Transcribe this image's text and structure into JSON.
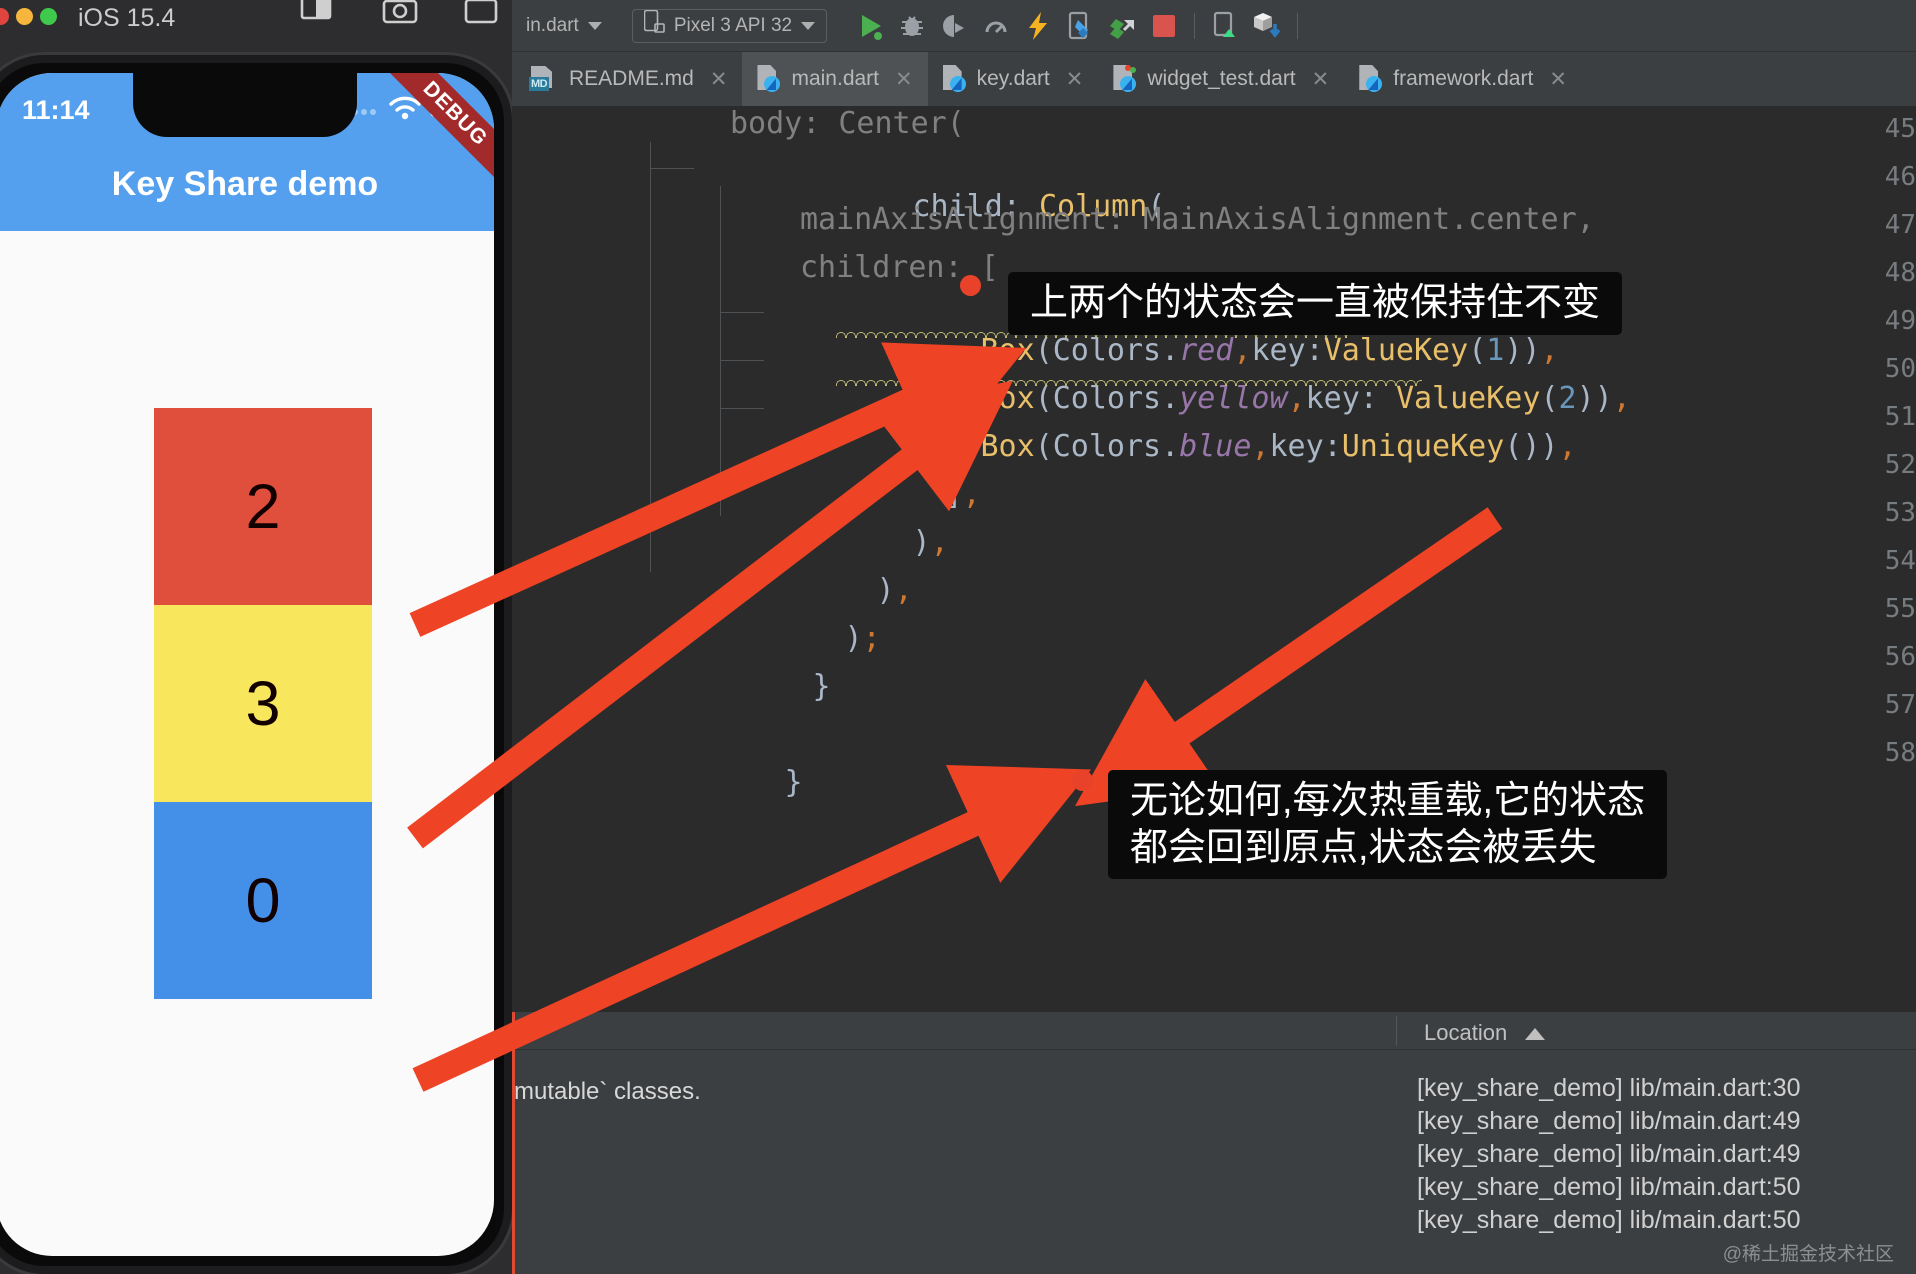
{
  "ide": {
    "toolbar": {
      "run_config": "in.dart",
      "device": "Pixel 3 API 32",
      "icons": [
        "run-icon",
        "debug-icon",
        "profile-icon",
        "coverage-icon",
        "hot-reload-icon",
        "flutter-inspector-icon",
        "flutter-outline-icon",
        "stop-icon",
        "device-manager-icon",
        "sdk-manager-icon"
      ]
    },
    "tabs": [
      {
        "label": "README.md",
        "icon": "markdown-file-icon",
        "active": false
      },
      {
        "label": "main.dart",
        "icon": "dart-file-icon",
        "active": true
      },
      {
        "label": "key.dart",
        "icon": "dart-file-icon",
        "active": false
      },
      {
        "label": "widget_test.dart",
        "icon": "flutter-test-file-icon",
        "active": false
      },
      {
        "label": "framework.dart",
        "icon": "dart-file-icon",
        "active": false
      }
    ],
    "editor": {
      "lines": [
        {
          "num": "45",
          "text": "body: Center("
        },
        {
          "num": "46",
          "text": "child: Column("
        },
        {
          "num": "47",
          "text": "mainAxisAlignment: MainAxisAlignment.center,"
        },
        {
          "num": "48",
          "text": "children: ["
        },
        {
          "num": "49",
          "text": "Box(Colors.red,key:ValueKey(1)),"
        },
        {
          "num": "50",
          "text": "Box(Colors.yellow,key: ValueKey(2)),"
        },
        {
          "num": "51",
          "text": "Box(Colors.blue,key:UniqueKey()),"
        },
        {
          "num": "52",
          "text": "],"
        },
        {
          "num": "53",
          "text": "),"
        },
        {
          "num": "54",
          "text": "),"
        },
        {
          "num": "55",
          "text": ");"
        },
        {
          "num": "56",
          "text": "}"
        },
        {
          "num": "57",
          "text": ""
        },
        {
          "num": "58",
          "text": "}"
        }
      ],
      "gutter_swatches": [
        "#e8432a",
        "#f6e23c",
        "#3f8fe8"
      ]
    },
    "bottom_panel": {
      "left_text": "mutable` classes.",
      "location_header": "Location",
      "sort_direction": "ascending",
      "locations": [
        "[key_share_demo] lib/main.dart:30",
        "[key_share_demo] lib/main.dart:49",
        "[key_share_demo] lib/main.dart:49",
        "[key_share_demo] lib/main.dart:50",
        "[key_share_demo] lib/main.dart:50"
      ]
    },
    "watermark": "@稀土掘金技术社区"
  },
  "simulator": {
    "os_label": "iOS 15.4",
    "window_icons": [
      "close-button",
      "minimize-button",
      "maximize-button"
    ],
    "toolbar_icons": [
      "home-indicator-icon",
      "screenshot-icon",
      "record-icon"
    ],
    "status_bar": {
      "time": "11:14",
      "wifi": "wifi-icon",
      "battery": "battery-icon"
    },
    "app_bar_title": "Key Share demo",
    "debug_banner": "DEBUG",
    "boxes": [
      {
        "label": "2",
        "color": "#e04e3c"
      },
      {
        "label": "3",
        "color": "#f8e75c"
      },
      {
        "label": "0",
        "color": "#4490e8"
      }
    ]
  },
  "annotations": {
    "accent_color": "#ee4324",
    "callouts": [
      {
        "id": "callout-top",
        "text": "上两个的状态会一直被保持住不变"
      },
      {
        "id": "callout-bottom",
        "text": "无论如何,每次热重载,它的状态\n都会回到原点,状态会被丢失"
      }
    ]
  }
}
